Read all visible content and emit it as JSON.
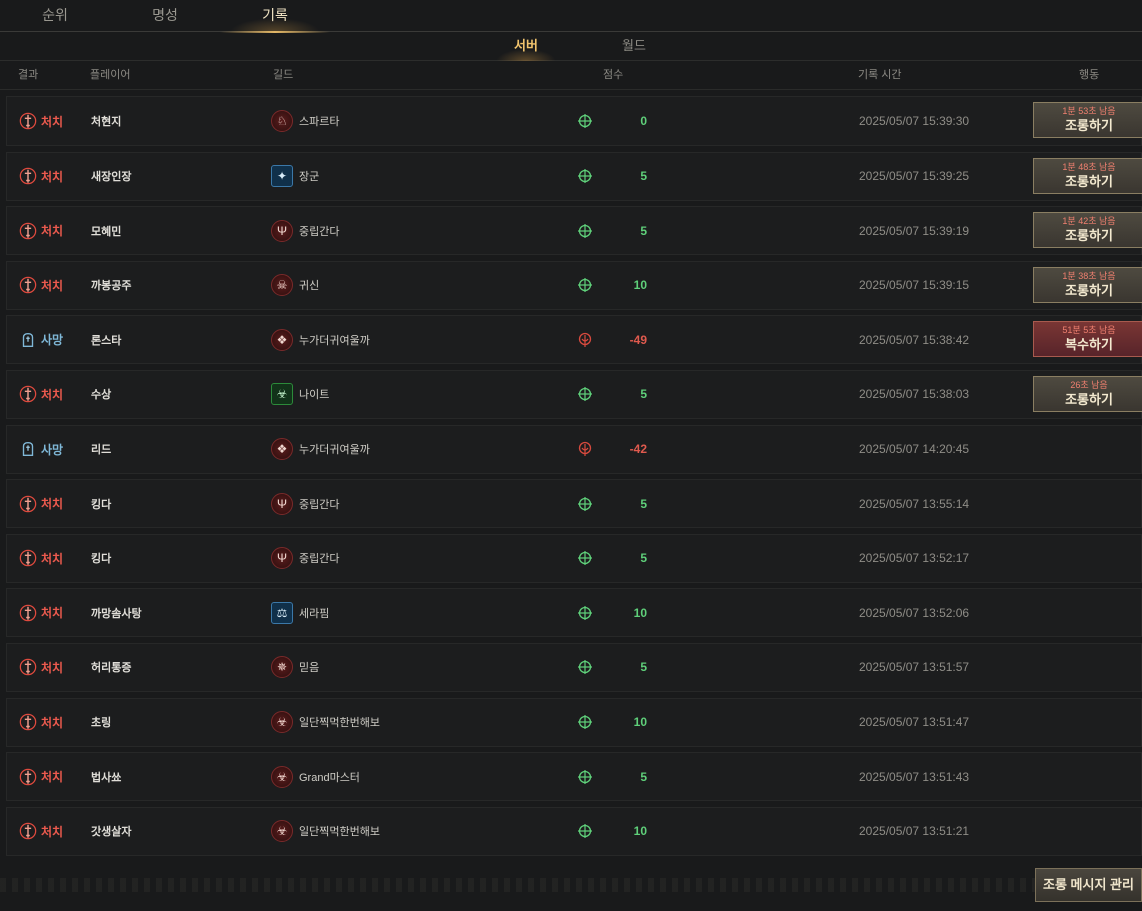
{
  "top_tabs": [
    {
      "label": "순위"
    },
    {
      "label": "명성"
    },
    {
      "label": "기록"
    }
  ],
  "sub_tabs": [
    {
      "label": "서버"
    },
    {
      "label": "월드"
    }
  ],
  "header": {
    "result": "결과",
    "player": "플레이어",
    "guild": "길드",
    "score": "점수",
    "time": "기록 시간",
    "action": "행동"
  },
  "records": [
    {
      "result": "처치",
      "type": "kill",
      "player": "처현지",
      "guild": "스파르타",
      "guild_icon": "spartan-helmet-icon",
      "guild_style": "red",
      "score": "0",
      "score_icon": "crosshair-icon",
      "time": "2025/05/07 15:39:30",
      "remain": "1분 53초 남음",
      "action": "조롱하기"
    },
    {
      "result": "처치",
      "type": "kill",
      "player": "새장인장",
      "guild": "장군",
      "guild_icon": "eagle-shield-icon",
      "guild_style": "blue",
      "score": "5",
      "score_icon": "crosshair-icon",
      "time": "2025/05/07 15:39:25",
      "remain": "1분 48초 남음",
      "action": "조롱하기"
    },
    {
      "result": "처치",
      "type": "kill",
      "player": "모혜민",
      "guild": "중립간다",
      "guild_icon": "trident-icon",
      "guild_style": "red",
      "score": "5",
      "score_icon": "crosshair-icon",
      "time": "2025/05/07 15:39:19",
      "remain": "1분 42초 남음",
      "action": "조롱하기"
    },
    {
      "result": "처치",
      "type": "kill",
      "player": "까봉공주",
      "guild": "귀신",
      "guild_icon": "skull-icon",
      "guild_style": "red",
      "score": "10",
      "score_icon": "crosshair-icon",
      "time": "2025/05/07 15:39:15",
      "remain": "1분 38초 남음",
      "action": "조롱하기"
    },
    {
      "result": "사망",
      "type": "death",
      "player": "론스타",
      "guild": "누가더귀여울까",
      "guild_icon": "emblem-icon",
      "guild_style": "red",
      "score": "-49",
      "score_icon": "death-mark-icon",
      "time": "2025/05/07 15:38:42",
      "remain": "51분 5초 남음",
      "action": "복수하기"
    },
    {
      "result": "처치",
      "type": "kill",
      "player": "수상",
      "guild": "나이트",
      "guild_icon": "biohazard-icon",
      "guild_style": "green",
      "score": "5",
      "score_icon": "crosshair-icon",
      "time": "2025/05/07 15:38:03",
      "remain": "26초 남음",
      "action": "조롱하기"
    },
    {
      "result": "사망",
      "type": "death",
      "player": "리드",
      "guild": "누가더귀여울까",
      "guild_icon": "emblem-icon",
      "guild_style": "red",
      "score": "-42",
      "score_icon": "death-mark-icon",
      "time": "2025/05/07 14:20:45",
      "remain": "",
      "action": ""
    },
    {
      "result": "처치",
      "type": "kill",
      "player": "킹다",
      "guild": "중립간다",
      "guild_icon": "trident-icon",
      "guild_style": "red",
      "score": "5",
      "score_icon": "crosshair-icon",
      "time": "2025/05/07 13:55:14",
      "remain": "",
      "action": ""
    },
    {
      "result": "처치",
      "type": "kill",
      "player": "킹다",
      "guild": "중립간다",
      "guild_icon": "trident-icon",
      "guild_style": "red",
      "score": "5",
      "score_icon": "crosshair-icon",
      "time": "2025/05/07 13:52:17",
      "remain": "",
      "action": ""
    },
    {
      "result": "처치",
      "type": "kill",
      "player": "까망솜사탕",
      "guild": "세라핌",
      "guild_icon": "scales-icon",
      "guild_style": "blue",
      "score": "10",
      "score_icon": "crosshair-icon",
      "time": "2025/05/07 13:52:06",
      "remain": "",
      "action": ""
    },
    {
      "result": "처치",
      "type": "kill",
      "player": "허리통증",
      "guild": "믿음",
      "guild_icon": "star-emblem-icon",
      "guild_style": "red",
      "score": "5",
      "score_icon": "crosshair-icon",
      "time": "2025/05/07 13:51:57",
      "remain": "",
      "action": ""
    },
    {
      "result": "처치",
      "type": "kill",
      "player": "초링",
      "guild": "일단찍먹한번해보",
      "guild_icon": "biohazard-icon",
      "guild_style": "red",
      "score": "10",
      "score_icon": "crosshair-icon",
      "time": "2025/05/07 13:51:47",
      "remain": "",
      "action": ""
    },
    {
      "result": "처치",
      "type": "kill",
      "player": "법사쑈",
      "guild": "Grand마스터",
      "guild_icon": "biohazard-icon",
      "guild_style": "red",
      "score": "5",
      "score_icon": "crosshair-icon",
      "time": "2025/05/07 13:51:43",
      "remain": "",
      "action": ""
    },
    {
      "result": "처치",
      "type": "kill",
      "player": "갓생살자",
      "guild": "일단찍먹한번해보",
      "guild_icon": "biohazard-icon",
      "guild_style": "red",
      "score": "10",
      "score_icon": "crosshair-icon",
      "time": "2025/05/07 13:51:21",
      "remain": "",
      "action": ""
    }
  ],
  "manage_button": "조롱 메시지 관리",
  "colors": {
    "kill": "#ec5a4e",
    "death": "#7fb8d8",
    "score_positive": "#5fd07a",
    "score_negative": "#e05a4e",
    "active_tab": "#f0c36d"
  }
}
